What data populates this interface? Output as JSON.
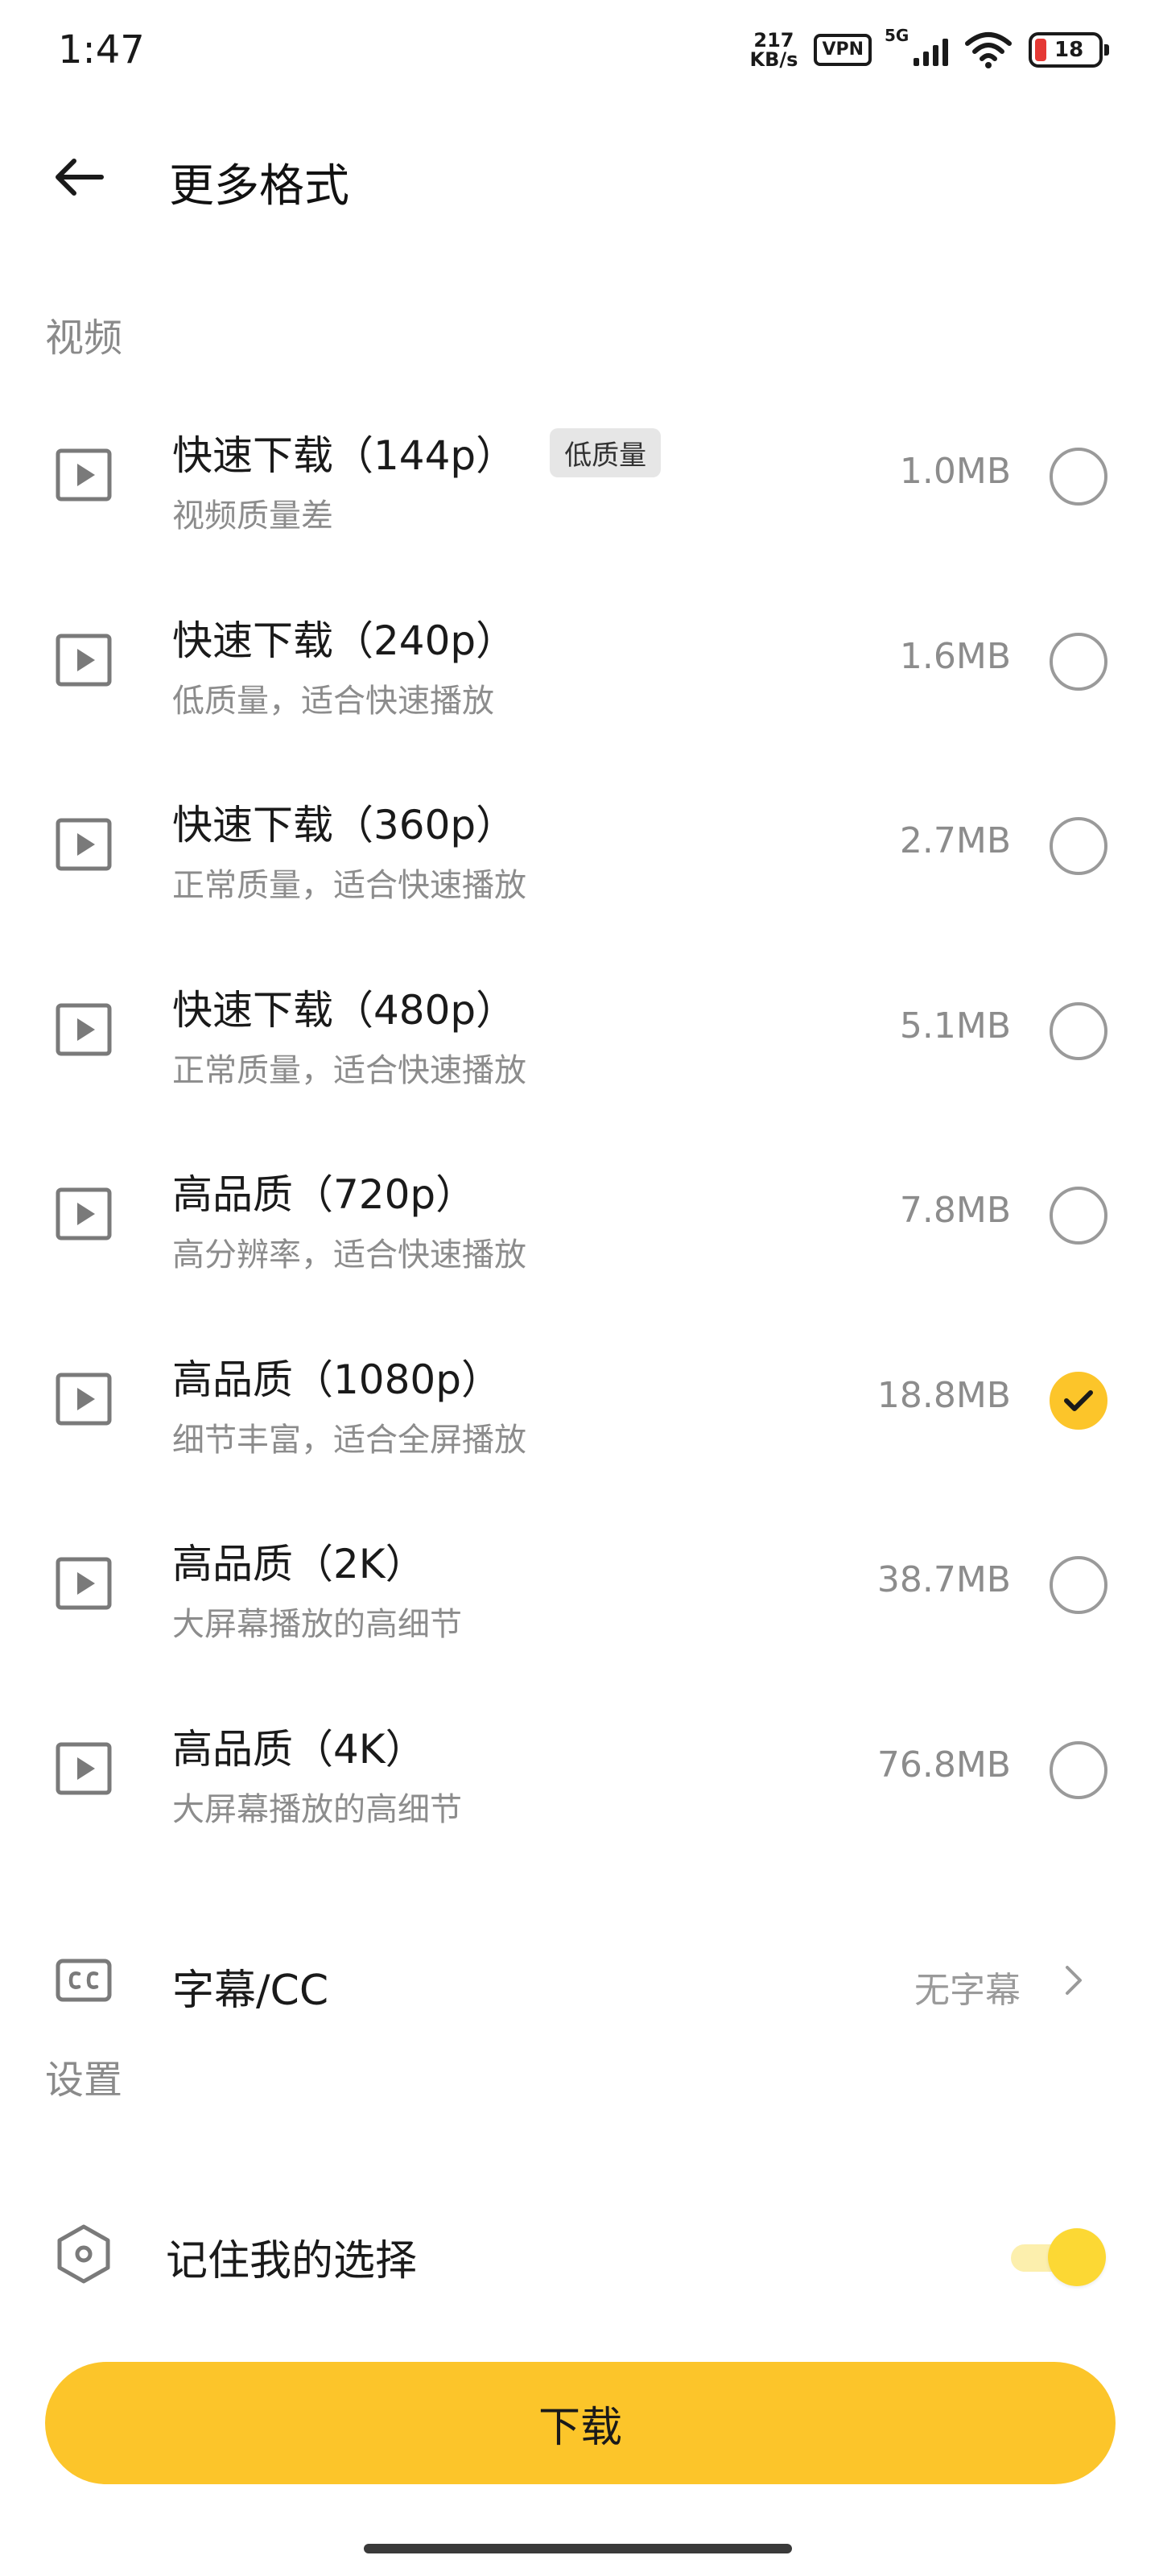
{
  "status_bar": {
    "time": "1:47",
    "net_speed_value": "217",
    "net_speed_unit": "KB/s",
    "vpn": "VPN",
    "network": "5G",
    "battery": "18"
  },
  "header": {
    "title": "更多格式"
  },
  "sections": {
    "video": "视频",
    "settings": "设置"
  },
  "formats": [
    {
      "title": "快速下载（144p）",
      "badge": "低质量",
      "subtitle": "视频质量差",
      "size": "1.0MB",
      "selected": false
    },
    {
      "title": "快速下载（240p）",
      "subtitle": "低质量，适合快速播放",
      "size": "1.6MB",
      "selected": false
    },
    {
      "title": "快速下载（360p）",
      "subtitle": "正常质量，适合快速播放",
      "size": "2.7MB",
      "selected": false
    },
    {
      "title": "快速下载（480p）",
      "subtitle": "正常质量，适合快速播放",
      "size": "5.1MB",
      "selected": false
    },
    {
      "title": "高品质（720p）",
      "subtitle": "高分辨率，适合快速播放",
      "size": "7.8MB",
      "selected": false
    },
    {
      "title": "高品质（1080p）",
      "subtitle": "细节丰富，适合全屏播放",
      "size": "18.8MB",
      "selected": true
    },
    {
      "title": "高品质（2K）",
      "subtitle": "大屏幕播放的高细节",
      "size": "38.7MB",
      "selected": false
    },
    {
      "title": "高品质（4K）",
      "subtitle": "大屏幕播放的高细节",
      "size": "76.8MB",
      "selected": false
    }
  ],
  "subtitles_row": {
    "label": "字幕/CC",
    "value": "无字幕"
  },
  "remember": {
    "label": "记住我的选择",
    "enabled": true
  },
  "download_button": {
    "label": "下载"
  },
  "colors": {
    "accent": "#fcc52a",
    "toggle_track": "#fcefad",
    "secondary_text": "#8c8c8c"
  }
}
